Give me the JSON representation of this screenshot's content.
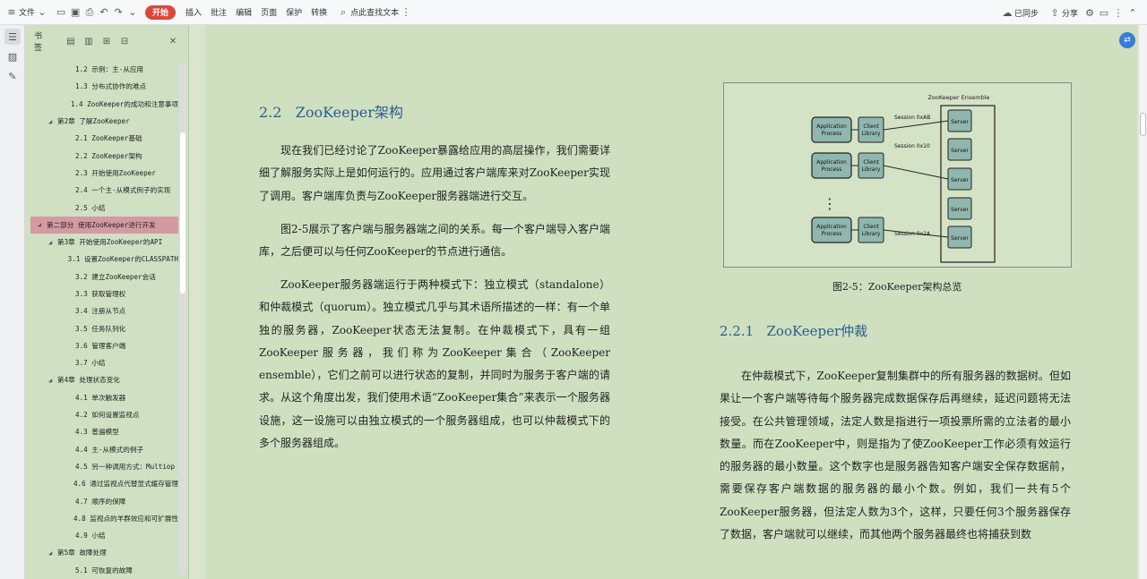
{
  "toolbar": {
    "file_label": "文件",
    "start_label": "开始",
    "insert_label": "插入",
    "comment_label": "批注",
    "edit_label": "编辑",
    "page_label": "页面",
    "protect_label": "保护",
    "convert_label": "转换",
    "search_label": "点此查找文本",
    "sync_label": "已同步",
    "share_label": "分享"
  },
  "bookmark": {
    "title": "书签",
    "items": [
      {
        "text": "1.2 示例：主-从应用",
        "level": 2,
        "arrow": ""
      },
      {
        "text": "1.3 分布式协作的难点",
        "level": 2,
        "arrow": ""
      },
      {
        "text": "1.4 ZooKeeper的成功和注意事项",
        "level": 2,
        "arrow": ""
      },
      {
        "text": "第2章 了解ZooKeeper",
        "level": 1,
        "arrow": "◢"
      },
      {
        "text": "2.1 ZooKeeper基础",
        "level": 2,
        "arrow": ""
      },
      {
        "text": "2.2 ZooKeeper架构",
        "level": 2,
        "arrow": ""
      },
      {
        "text": "2.3 开始使用ZooKeeper",
        "level": 2,
        "arrow": ""
      },
      {
        "text": "2.4 一个主-从模式例子的实现",
        "level": 2,
        "arrow": ""
      },
      {
        "text": "2.5 小结",
        "level": 2,
        "arrow": ""
      },
      {
        "text": "第二部分 使用ZooKeeper进行开发",
        "level": 0,
        "arrow": "◢",
        "selected": true
      },
      {
        "text": "第3章 开始使用ZooKeeper的API",
        "level": 1,
        "arrow": "◢"
      },
      {
        "text": "3.1 设置ZooKeeper的CLASSPATH",
        "level": 2,
        "arrow": ""
      },
      {
        "text": "3.2 建立ZooKeeper会话",
        "level": 2,
        "arrow": ""
      },
      {
        "text": "3.3 获取管理权",
        "level": 2,
        "arrow": ""
      },
      {
        "text": "3.4 注册从节点",
        "level": 2,
        "arrow": ""
      },
      {
        "text": "3.5 任务队列化",
        "level": 2,
        "arrow": ""
      },
      {
        "text": "3.6 管理客户端",
        "level": 2,
        "arrow": ""
      },
      {
        "text": "3.7 小结",
        "level": 2,
        "arrow": ""
      },
      {
        "text": "第4章 处理状态变化",
        "level": 1,
        "arrow": "◢"
      },
      {
        "text": "4.1 单次触发器",
        "level": 2,
        "arrow": ""
      },
      {
        "text": "4.2 如何设置监视点",
        "level": 2,
        "arrow": ""
      },
      {
        "text": "4.3 普遍模型",
        "level": 2,
        "arrow": ""
      },
      {
        "text": "4.4 主-从模式的例子",
        "level": 2,
        "arrow": ""
      },
      {
        "text": "4.5 另一种调用方式：Multiop",
        "level": 2,
        "arrow": ""
      },
      {
        "text": "4.6 通过监视点代替显式缓存管理",
        "level": 2,
        "arrow": ""
      },
      {
        "text": "4.7 顺序的保障",
        "level": 2,
        "arrow": ""
      },
      {
        "text": "4.8 监视点的羊群效应和可扩展性",
        "level": 2,
        "arrow": ""
      },
      {
        "text": "4.9 小结",
        "level": 2,
        "arrow": ""
      },
      {
        "text": "第5章 故障处理",
        "level": 1,
        "arrow": "◢"
      },
      {
        "text": "5.1 可恢复的故障",
        "level": 2,
        "arrow": ""
      }
    ]
  },
  "doc": {
    "left_heading_num": "2.2",
    "left_heading": "ZooKeeper架构",
    "left_p1": "现在我们已经讨论了ZooKeeper暴露给应用的高层操作，我们需要详细了解服务实际上是如何运行的。应用通过客户端库来对ZooKeeper实现了调用。客户端库负责与ZooKeeper服务器端进行交互。",
    "left_p2": "图2-5展示了客户端与服务器端之间的关系。每一个客户端导入客户端库，之后便可以与任何ZooKeeper的节点进行通信。",
    "left_p3": "ZooKeeper服务器端运行于两种模式下：独立模式（standalone）和仲裁模式（quorum）。独立模式几乎与其术语所描述的一样：有一个单独的服务器，ZooKeeper状态无法复制。在仲裁模式下，具有一组ZooKeeper服务器，我们称为ZooKeeper集合（ZooKeeper ensemble），它们之前可以进行状态的复制，并同时为服务于客户端的请求。从这个角度出发，我们使用术语“ZooKeeper集合”来表示一个服务器设施，这一设施可以由独立模式的一个服务器组成，也可以仲裁模式下的多个服务器组成。",
    "figure_caption": "图2-5：ZooKeeper架构总览",
    "right_heading_num": "2.2.1",
    "right_heading": "ZooKeeper仲裁",
    "right_p1": "在仲裁模式下，ZooKeeper复制集群中的所有服务器的数据树。但如果让一个客户端等待每个服务器完成数据保存后再继续，延迟问题将无法接受。在公共管理领域，法定人数是指进行一项投票所需的立法者的最小数量。而在ZooKeeper中，则是指为了使ZooKeeper工作必须有效运行的服务器的最小数量。这个数字也是服务器告知客户端安全保存数据前，需要保存客户端数据的服务器的最小个数。例如，我们一共有5个ZooKeeper服务器，但法定人数为3个，这样，只要任何3个服务器保存了数据，客户端就可以继续，而其他两个服务器最终也将捕获到数"
  },
  "figure": {
    "ensemble_label": "ZooKeeper Ensemble",
    "app_label_1": "Application",
    "app_label_2": "Process",
    "lib_label_1": "Client",
    "lib_label_2": "Library",
    "server_label": "Server",
    "session1": "Session 0xAB",
    "session2": "Session 0x10",
    "session3": "Session 0x2A",
    "dots": "⋮"
  },
  "colors": {
    "accent": "#e0453b",
    "heading": "#2a5c8f",
    "selected": "#d49aa2",
    "box": "#8fb7ad"
  }
}
